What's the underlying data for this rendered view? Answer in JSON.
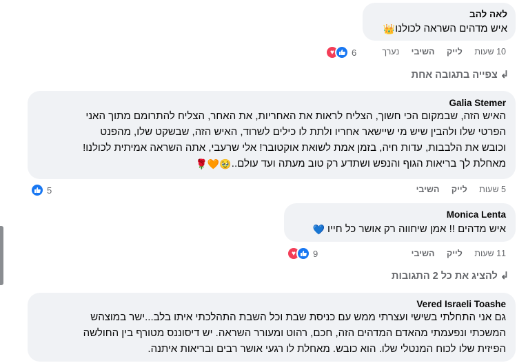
{
  "comments": [
    {
      "author": "לאה להב",
      "text": "איש מדהים השראה לכולנו",
      "emoji": "👑",
      "time": "10 שעות",
      "like_label": "לייק",
      "reply_label": "השיבי",
      "edited_label": "נערך",
      "reaction_count": "6"
    },
    {
      "author": "Galia Stemer",
      "lines": [
        "האיש הזה, שבמקום הכי חשוך, הצליח לראות את האחריות, את האחר, הצליח להתרומם מתוך האני",
        "הפרטי שלו ולהבין שיש מי שיישאר אחריו ולתת לו כילים לשרוד, האיש הזה, שבשקט שלו, מהפנט",
        "וכובש את הלבבות, עדות חיה, בזמן אמת לשואת אוקטובר! אלי שרעבי, אתה השראה אמיתית לכולנו!",
        "מאחלת לך בריאות הגוף והנפש ושתדע רק טוב מעתה ועד עולם.."
      ],
      "emojis": "🥹🧡🌹",
      "time": "5 שעות",
      "like_label": "לייק",
      "reply_label": "השיבי",
      "reaction_count": "5"
    },
    {
      "author": "Monica Lenta",
      "text": "איש מדהים !! אמן שיחווה רק אושר כל חייו",
      "emoji": "💙",
      "time": "11 שעות",
      "like_label": "לייק",
      "reply_label": "השיבי",
      "reaction_count": "9"
    },
    {
      "author": "Vered Israeli Toashe",
      "lines": [
        "גם אני התחלתי בשישי ועצרתי ממש עם כניסת שבת וכל השבת התהלכתי איתו בלב...ישר במוצהש",
        "המשכתי ונפעמתי מהאדם המדהים הזה, חכם, רהוט ומעורר השראה. יש דיסוננס מטורף בין החולשה",
        "הפיזית שלו לכוח המנטלי שלו. הוא כובש. מאחלת לו רגעי אושר רבים ובריאות איתנה."
      ]
    }
  ],
  "view_replies_1": "צפייה בתגובה אחת",
  "view_replies_2": "להציג את כל 2 התגובות",
  "colors": {
    "bubble": "#f0f2f5",
    "meta": "#65676b",
    "like": "#1877f2",
    "love": "#f33e58"
  },
  "icons": [
    "reply-arrow-icon",
    "like-reaction-icon",
    "love-reaction-icon"
  ]
}
